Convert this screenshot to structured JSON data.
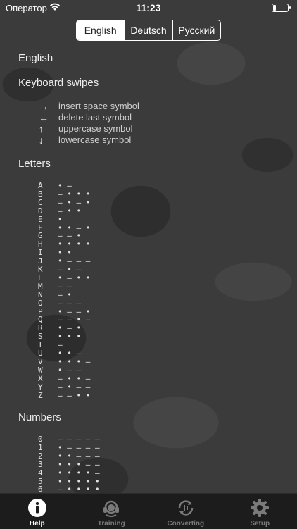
{
  "status_bar": {
    "carrier": "Оператор",
    "time": "11:23"
  },
  "languages": [
    {
      "label": "English",
      "selected": true
    },
    {
      "label": "Deutsch",
      "selected": false
    },
    {
      "label": "Русский",
      "selected": false
    }
  ],
  "content": {
    "language_heading": "English",
    "swipes_heading": "Keyboard swipes",
    "swipes": [
      {
        "arrow": "→",
        "text": "insert space symbol"
      },
      {
        "arrow": "←",
        "text": "delete last symbol"
      },
      {
        "arrow": "↑",
        "text": "uppercase symbol"
      },
      {
        "arrow": "↓",
        "text": "lowercase symbol"
      }
    ],
    "letters_heading": "Letters",
    "letters": [
      {
        "char": "A",
        "code": "• –"
      },
      {
        "char": "B",
        "code": "– • • •"
      },
      {
        "char": "C",
        "code": "– • – •"
      },
      {
        "char": "D",
        "code": "– • •"
      },
      {
        "char": "E",
        "code": "•"
      },
      {
        "char": "F",
        "code": "• • – •"
      },
      {
        "char": "G",
        "code": "– – •"
      },
      {
        "char": "H",
        "code": "• • • •"
      },
      {
        "char": "I",
        "code": "• •"
      },
      {
        "char": "J",
        "code": "• – – –"
      },
      {
        "char": "K",
        "code": "– • –"
      },
      {
        "char": "L",
        "code": "• – • •"
      },
      {
        "char": "M",
        "code": "– –"
      },
      {
        "char": "N",
        "code": "– •"
      },
      {
        "char": "O",
        "code": "– – –"
      },
      {
        "char": "P",
        "code": "• – – •"
      },
      {
        "char": "Q",
        "code": "– – • –"
      },
      {
        "char": "R",
        "code": "• – •"
      },
      {
        "char": "S",
        "code": "• • •"
      },
      {
        "char": "T",
        "code": "–"
      },
      {
        "char": "U",
        "code": "• • –"
      },
      {
        "char": "V",
        "code": "• • • –"
      },
      {
        "char": "W",
        "code": "• – –"
      },
      {
        "char": "X",
        "code": "– • • –"
      },
      {
        "char": "Y",
        "code": "– • – –"
      },
      {
        "char": "Z",
        "code": "– – • •"
      }
    ],
    "numbers_heading": "Numbers",
    "numbers": [
      {
        "char": "0",
        "code": "– – – – –"
      },
      {
        "char": "1",
        "code": "• – – – –"
      },
      {
        "char": "2",
        "code": "• • – – –"
      },
      {
        "char": "3",
        "code": "• • • – –"
      },
      {
        "char": "4",
        "code": "• • • • –"
      },
      {
        "char": "5",
        "code": "• • • • •"
      },
      {
        "char": "6",
        "code": "– • • • •"
      }
    ]
  },
  "tabs": [
    {
      "label": "Help",
      "icon": "info-icon",
      "active": true
    },
    {
      "label": "Training",
      "icon": "headphones-icon",
      "active": false
    },
    {
      "label": "Converting",
      "icon": "convert-icon",
      "active": false
    },
    {
      "label": "Setup",
      "icon": "gear-icon",
      "active": false
    }
  ]
}
